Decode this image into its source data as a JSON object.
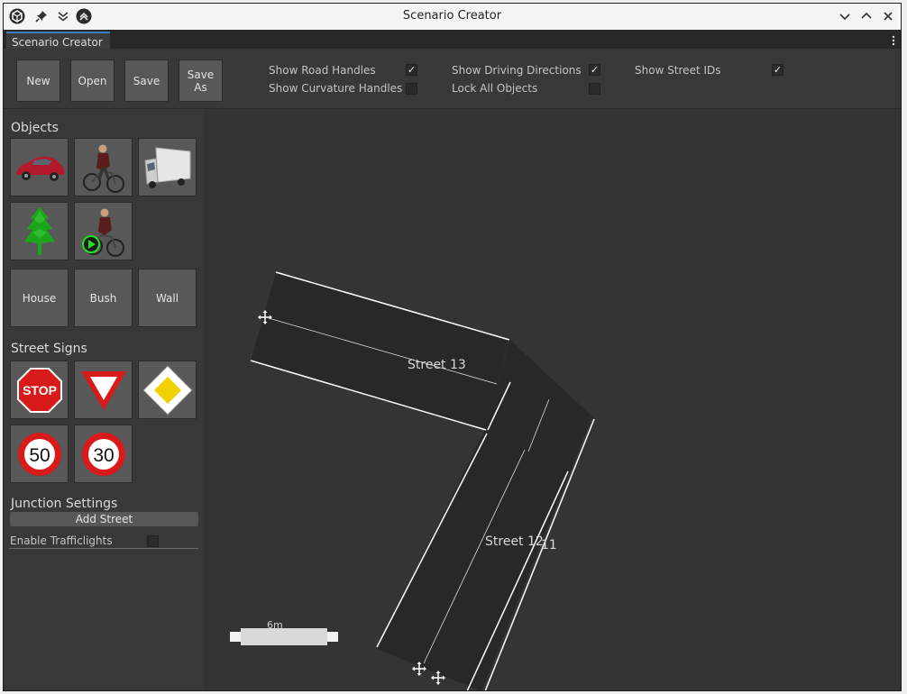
{
  "window": {
    "title": "Scenario Creator"
  },
  "titlebar_icons": {
    "app": "app-logo-icon",
    "pin": "pin-icon",
    "collapse": "double-chevron-down-icon",
    "menu": "circle-chevron-up-icon"
  },
  "window_controls": [
    "minimize-icon",
    "maximize-icon",
    "close-icon"
  ],
  "tab": {
    "label": "Scenario Creator"
  },
  "toolbar": {
    "buttons": {
      "new": "New",
      "open": "Open",
      "save": "Save",
      "save_as_1": "Save",
      "save_as_2": "As"
    },
    "options": [
      {
        "label": "Show Road Handles",
        "checked": true
      },
      {
        "label": "Show Curvature Handles",
        "checked": false
      },
      {
        "label": "Show Driving Directions",
        "checked": true
      },
      {
        "label": "Lock All Objects",
        "checked": false
      },
      {
        "label": "Show Street IDs",
        "checked": true
      }
    ]
  },
  "objects": {
    "title": "Objects",
    "tiles": [
      "car-icon",
      "cyclist-icon",
      "truck-icon",
      "tree-icon",
      "animated-cyclist-icon"
    ],
    "labels": {
      "house": "House",
      "bush": "Bush",
      "wall": "Wall"
    }
  },
  "street_signs": {
    "title": "Street Signs",
    "stop_text": "STOP",
    "speed_50": "50",
    "speed_30": "30",
    "icons": [
      "stop-sign-icon",
      "yield-sign-icon",
      "priority-road-sign-icon",
      "speed-limit-50-icon",
      "speed-limit-30-icon"
    ]
  },
  "junction": {
    "title": "Junction Settings",
    "add_street": "Add Street",
    "enable_trafficlights": "Enable Trafficlights",
    "trafficlights_checked": false
  },
  "scene": {
    "street_label_1": "Street 13",
    "street_label_2": "Street 12",
    "street_label_2_overlap": "11",
    "scale_label": "6m"
  },
  "colors": {
    "accent": "#3a79bb",
    "panel": "#383838",
    "scene": "#343434",
    "road": "#282828",
    "button": "#585858"
  }
}
